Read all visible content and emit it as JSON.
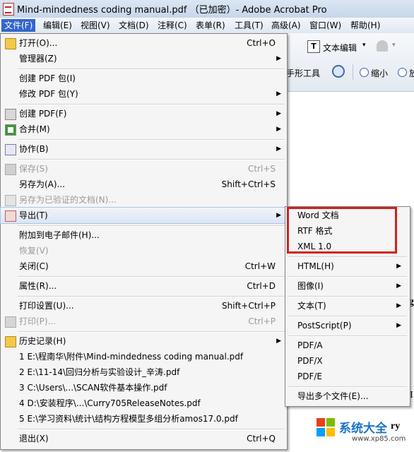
{
  "window": {
    "title": "Mind-mindedness coding manual.pdf （已加密）- Adobe Acrobat Pro"
  },
  "menubar": [
    "文件(F)",
    "编辑(E)",
    "视图(V)",
    "文档(D)",
    "注释(C)",
    "表单(R)",
    "工具(T)",
    "高级(A)",
    "窗口(W)",
    "帮助(H)"
  ],
  "toolbar": {
    "text_edit": "文本编辑",
    "hand_tool": "手形工具",
    "zoom_out": "缩小",
    "zoom_in_partial": "放"
  },
  "file_menu": [
    {
      "label": "打开(O)...",
      "shortcut": "Ctrl+O",
      "icon": "open-folder-icon"
    },
    {
      "label": "管理器(Z)",
      "submenu": true
    },
    {
      "label": "创建 PDF 包(I)"
    },
    {
      "label": "修改 PDF 包(Y)",
      "submenu": true
    },
    {
      "label": "创建 PDF(F)",
      "submenu": true,
      "icon": "create-pdf-icon"
    },
    {
      "label": "合并(M)",
      "submenu": true,
      "icon": "combine-icon"
    },
    {
      "label": "协作(B)",
      "submenu": true,
      "icon": "collaborate-icon"
    },
    {
      "label": "保存(S)",
      "shortcut": "Ctrl+S",
      "disabled": true,
      "icon": "save-icon"
    },
    {
      "label": "另存为(A)...",
      "shortcut": "Shift+Ctrl+S"
    },
    {
      "label": "另存为已验证的文档(N)...",
      "disabled": true,
      "icon": "certified-icon"
    },
    {
      "label": "导出(T)",
      "submenu": true,
      "highlighted": true,
      "icon": "export-icon"
    },
    {
      "label": "附加到电子邮件(H)..."
    },
    {
      "label": "恢复(V)",
      "disabled": true
    },
    {
      "label": "关闭(C)",
      "shortcut": "Ctrl+W"
    },
    {
      "label": "属性(R)...",
      "shortcut": "Ctrl+D"
    },
    {
      "label": "打印设置(U)...",
      "shortcut": "Shift+Ctrl+P"
    },
    {
      "label": "打印(P)...",
      "shortcut": "Ctrl+P",
      "disabled": true,
      "icon": "print-icon"
    },
    {
      "label": "历史记录(H)",
      "submenu": true,
      "icon": "history-icon"
    },
    {
      "label": "1 E:\\程南华\\附件\\Mind-mindedness coding manual.pdf"
    },
    {
      "label": "2 E:\\11-14\\回归分析与实验设计_辛涛.pdf"
    },
    {
      "label": "3 C:\\Users\\...\\SCAN软件基本操作.pdf"
    },
    {
      "label": "4 D:\\安装程序\\...\\Curry705ReleaseNotes.pdf"
    },
    {
      "label": "5 E:\\学习资料\\统计\\结构方程模型多组分析amos17.0.pdf"
    },
    {
      "label": "退出(X)",
      "shortcut": "Ctrl+Q"
    }
  ],
  "export_submenu": [
    {
      "label": "Word 文档"
    },
    {
      "label": "RTF 格式"
    },
    {
      "label": "XML 1.0"
    },
    {
      "label": "HTML(H)",
      "submenu": true
    },
    {
      "label": "图像(I)",
      "submenu": true
    },
    {
      "label": "文本(T)",
      "submenu": true
    },
    {
      "label": "PostScript(P)",
      "submenu": true
    },
    {
      "label": "PDF/A"
    },
    {
      "label": "PDF/X"
    },
    {
      "label": "PDF/E"
    },
    {
      "label": "导出多个文件(E)..."
    }
  ],
  "document_fragments": [
    "ng",
    "es I",
    "ry"
  ],
  "watermark": {
    "site": "系统大全",
    "url": "www.xp85.com"
  },
  "colors": {
    "highlight_box": "#d42020",
    "menu_active": "#3366cc"
  }
}
